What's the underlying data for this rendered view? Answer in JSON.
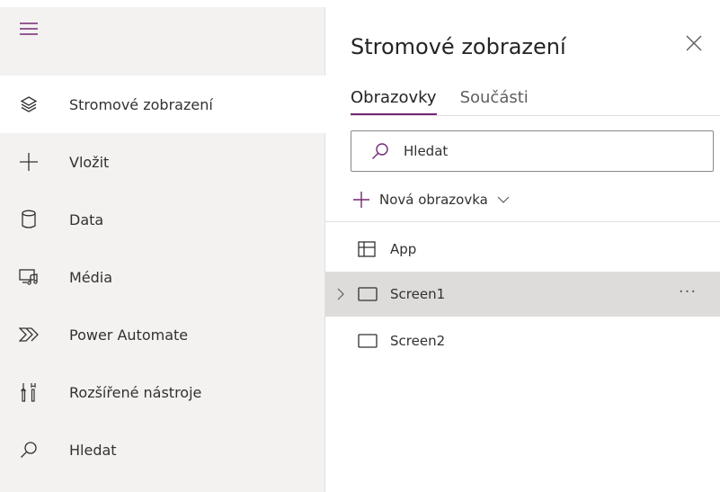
{
  "rail": {
    "items": [
      {
        "label": "Stromové zobrazení",
        "icon": "layers-icon",
        "active": true
      },
      {
        "label": "Vložit",
        "icon": "plus-icon"
      },
      {
        "label": "Data",
        "icon": "database-icon"
      },
      {
        "label": "Média",
        "icon": "media-icon"
      },
      {
        "label": "Power Automate",
        "icon": "power-automate-icon"
      },
      {
        "label": "Rozšířené nástroje",
        "icon": "advanced-tools-icon"
      },
      {
        "label": "Hledat",
        "icon": "search-icon"
      }
    ]
  },
  "panel": {
    "title": "Stromové zobrazení",
    "tabs": [
      {
        "label": "Obrazovky",
        "active": true
      },
      {
        "label": "Součásti",
        "active": false
      }
    ],
    "search": {
      "placeholder": "Hledat",
      "value": ""
    },
    "new_screen_label": "Nová obrazovka",
    "tree": [
      {
        "label": "App",
        "icon": "app-grid-icon"
      },
      {
        "label": "Screen1",
        "icon": "screen-icon",
        "selected": true,
        "expandable": true,
        "more": "···"
      },
      {
        "label": "Screen2",
        "icon": "screen-icon"
      }
    ]
  },
  "colors": {
    "accent": "#742774",
    "rail_bg": "#f3f2f1",
    "selected_row": "#dedcdb"
  }
}
